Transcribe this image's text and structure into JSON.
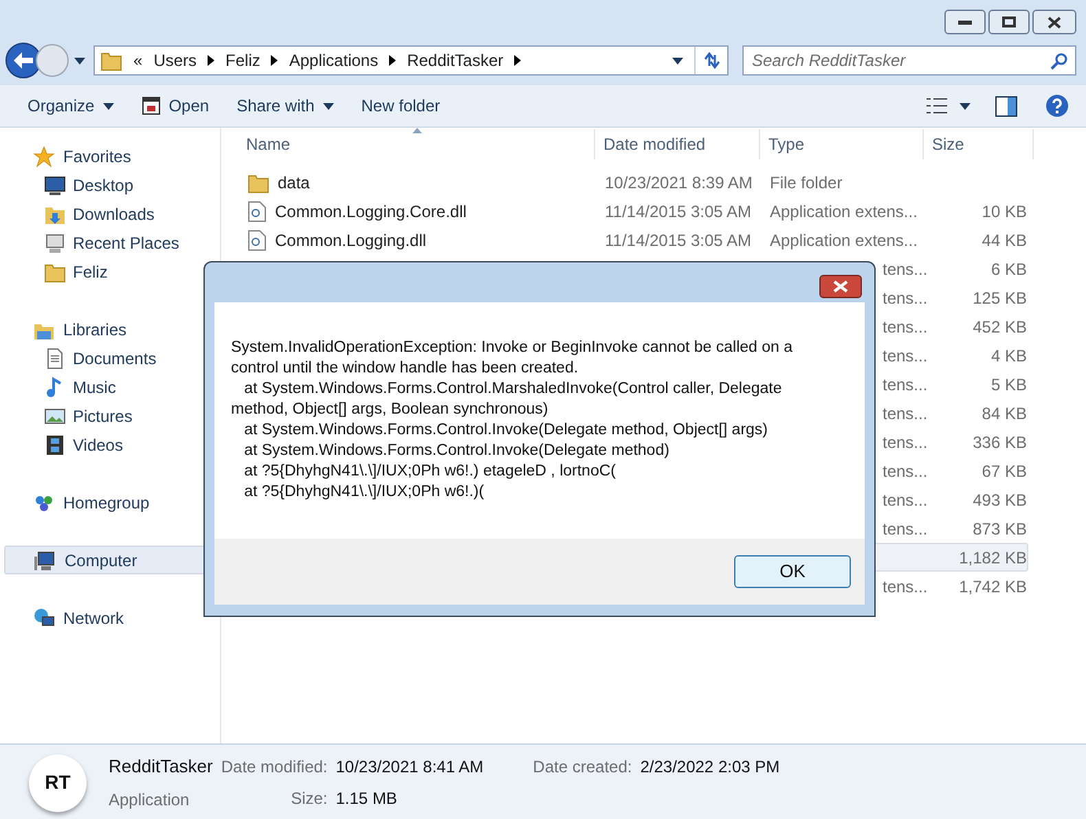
{
  "address": {
    "overflow": "«",
    "path": [
      "Users",
      "Feliz",
      "Applications",
      "RedditTasker"
    ]
  },
  "search": {
    "placeholder": "Search RedditTasker"
  },
  "toolbar": [
    {
      "label": "Organize",
      "kind": "menu"
    },
    {
      "label": "Open",
      "kind": "icon"
    },
    {
      "label": "Share with",
      "kind": "menu"
    },
    {
      "label": "New folder",
      "kind": "plain"
    }
  ],
  "sidebar": [
    {
      "label": "Favorites",
      "selected": false,
      "children": [
        {
          "label": "Desktop",
          "selected": false
        },
        {
          "label": "Downloads",
          "selected": false
        },
        {
          "label": "Recent Places",
          "selected": false
        },
        {
          "label": "Feliz",
          "selected": false
        }
      ]
    },
    {
      "label": "Libraries",
      "selected": false,
      "children": [
        {
          "label": "Documents",
          "selected": false
        },
        {
          "label": "Music",
          "selected": false
        },
        {
          "label": "Pictures",
          "selected": false
        },
        {
          "label": "Videos",
          "selected": false
        }
      ]
    },
    {
      "label": "Homegroup",
      "selected": false
    },
    {
      "label": "Computer",
      "selected": true
    },
    {
      "label": "Network",
      "selected": false
    }
  ],
  "file_list": {
    "columns": [
      "Name",
      "Date modified",
      "Type",
      "Size"
    ],
    "rows": [
      {
        "kind": "folder",
        "name": "data",
        "date": "10/23/2021 8:39 AM",
        "type": "File folder",
        "selected": false
      },
      {
        "kind": "dll",
        "name": "Common.Logging.Core.dll",
        "date": "11/14/2015 3:05 AM",
        "type": "Application extens...",
        "size": "10 KB",
        "selected": false
      },
      {
        "kind": "dll",
        "name": "Common.Logging.dll",
        "date": "11/14/2015 3:05 AM",
        "type": "Application extens...",
        "size": "44 KB",
        "selected": false
      },
      {
        "kind": "hidden",
        "type": "tens...",
        "size": "6 KB",
        "selected": false
      },
      {
        "kind": "hidden",
        "type": "tens...",
        "size": "125 KB",
        "selected": false
      },
      {
        "kind": "hidden",
        "type": "tens...",
        "size": "452 KB",
        "selected": false
      },
      {
        "kind": "hidden",
        "type": "tens...",
        "size": "4 KB",
        "selected": false
      },
      {
        "kind": "hidden",
        "type": "tens...",
        "size": "5 KB",
        "selected": false
      },
      {
        "kind": "hidden",
        "type": "tens...",
        "size": "84 KB",
        "selected": false
      },
      {
        "kind": "hidden",
        "type": "tens...",
        "size": "336 KB",
        "selected": false
      },
      {
        "kind": "hidden",
        "type": "tens...",
        "size": "67 KB",
        "selected": false
      },
      {
        "kind": "hidden",
        "type": "tens...",
        "size": "493 KB",
        "selected": false
      },
      {
        "kind": "hidden",
        "type": "tens...",
        "size": "873 KB",
        "selected": false
      },
      {
        "kind": "hidden",
        "size": "1,182 KB",
        "selected": true
      },
      {
        "kind": "hidden",
        "type": "tens...",
        "size": "1,742 KB",
        "selected": false
      }
    ]
  },
  "dialog": {
    "message_lines": [
      "System.InvalidOperationException: Invoke or BeginInvoke cannot be called on a",
      "control until the window handle has been created.",
      "   at System.Windows.Forms.Control.MarshaledInvoke(Control caller, Delegate",
      "method, Object[] args, Boolean synchronous)",
      "   at System.Windows.Forms.Control.Invoke(Delegate method, Object[] args)",
      "   at System.Windows.Forms.Control.Invoke(Delegate method)",
      "   at ?5{DhyhgN41\\.\\]/IUX;0Ph w6!.) etageleD , lortnoC(",
      "   at ?5{DhyhgN41\\.\\]/IUX;0Ph w6!.)("
    ],
    "button": "OK"
  },
  "details": {
    "icon_text": "RT",
    "name": "RedditTasker",
    "type": "Application",
    "fields": [
      {
        "label": "Date modified:",
        "value": "10/23/2021 8:41 AM"
      },
      {
        "label": "Size:",
        "value": "1.15 MB"
      },
      {
        "label": "Date created:",
        "value": "2/23/2022 2:03 PM"
      }
    ]
  }
}
